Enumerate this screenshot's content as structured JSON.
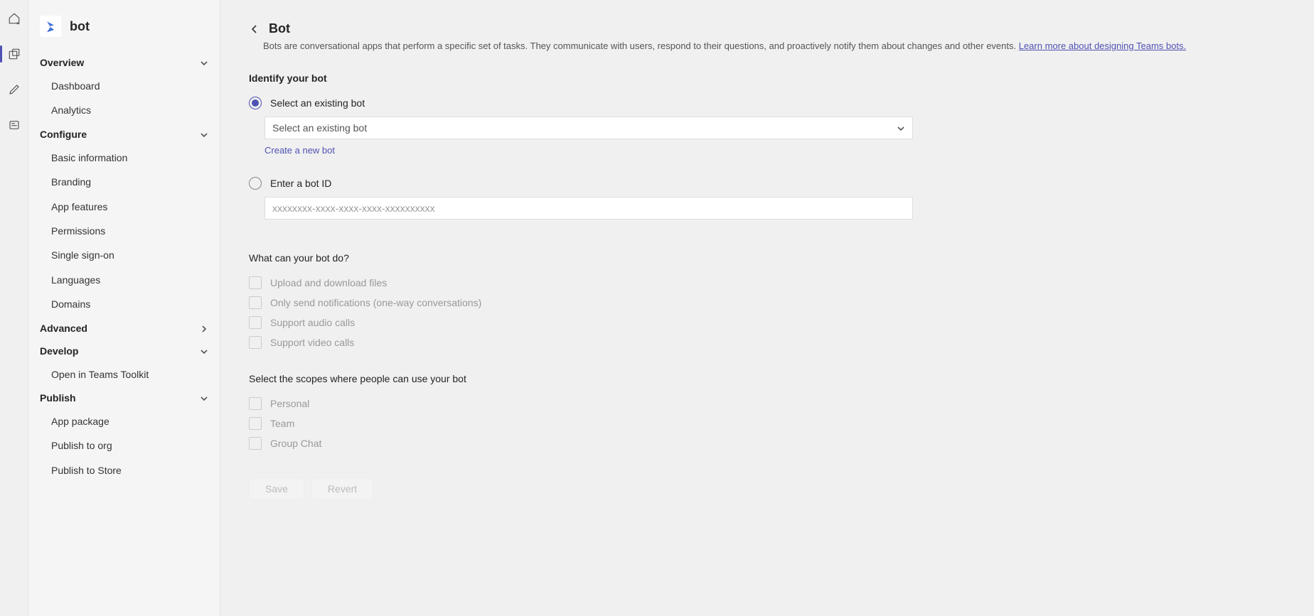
{
  "app": {
    "title": "bot"
  },
  "sidebar": {
    "sections": {
      "overview": {
        "label": "Overview",
        "items": [
          "Dashboard",
          "Analytics"
        ]
      },
      "configure": {
        "label": "Configure",
        "items": [
          "Basic information",
          "Branding",
          "App features",
          "Permissions",
          "Single sign-on",
          "Languages",
          "Domains"
        ]
      },
      "advanced": {
        "label": "Advanced",
        "items": []
      },
      "develop": {
        "label": "Develop",
        "items": [
          "Open in Teams Toolkit"
        ]
      },
      "publish": {
        "label": "Publish",
        "items": [
          "App package",
          "Publish to org",
          "Publish to Store"
        ]
      }
    }
  },
  "page": {
    "title": "Bot",
    "description": "Bots are conversational apps that perform a specific set of tasks. They communicate with users, respond to their questions, and proactively notify them about changes and other events. ",
    "learnMore": "Learn more about designing Teams bots."
  },
  "identify": {
    "heading": "Identify your bot",
    "selectExistingLabel": "Select an existing bot",
    "selectExistingPlaceholder": "Select an existing bot",
    "createNewLink": "Create a new bot",
    "enterIdLabel": "Enter a bot ID",
    "enterIdPlaceholder": "xxxxxxxx-xxxx-xxxx-xxxx-xxxxxxxxxx"
  },
  "capabilities": {
    "heading": "What can your bot do?",
    "opts": [
      "Upload and download files",
      "Only send notifications (one-way conversations)",
      "Support audio calls",
      "Support video calls"
    ]
  },
  "scopes": {
    "heading": "Select the scopes where people can use your bot",
    "opts": [
      "Personal",
      "Team",
      "Group Chat"
    ]
  },
  "buttons": {
    "save": "Save",
    "revert": "Revert"
  }
}
